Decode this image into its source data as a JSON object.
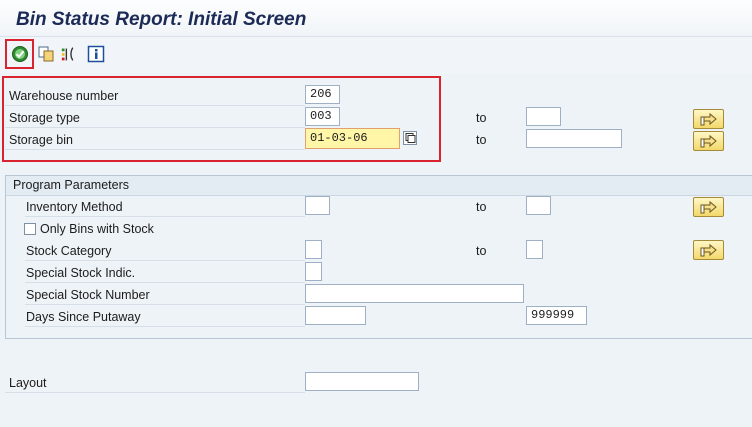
{
  "window": {
    "title": "Bin Status Report: Initial Screen"
  },
  "toolbar": {
    "items": [
      "execute-icon",
      "copy-variant-icon",
      "selection-options-icon",
      "info-icon"
    ]
  },
  "selection": {
    "warehouse": {
      "label": "Warehouse number",
      "value": "206"
    },
    "storage_type": {
      "label": "Storage type",
      "value": "003",
      "to_label": "to",
      "to_value": ""
    },
    "storage_bin": {
      "label": "Storage bin",
      "value": "01-03-06",
      "to_label": "to",
      "to_value": ""
    }
  },
  "program_parameters": {
    "title": "Program Parameters",
    "inventory_method": {
      "label": "Inventory Method",
      "value": "",
      "to_label": "to",
      "to_value": ""
    },
    "only_bins_with_stock": {
      "label": "Only Bins with Stock",
      "checked": false
    },
    "stock_category": {
      "label": "Stock Category",
      "value": "",
      "to_label": "to",
      "to_value": ""
    },
    "special_stock_indic": {
      "label": "Special Stock Indic.",
      "value": ""
    },
    "special_stock_number": {
      "label": "Special Stock Number",
      "value": ""
    },
    "days_since_putaway": {
      "label": "Days Since Putaway",
      "value": "",
      "to_value": "999999"
    }
  },
  "layout": {
    "label": "Layout",
    "value": ""
  },
  "colors": {
    "highlight": "#d9232e",
    "focus_field": "#fff6a8",
    "title": "#1b2a57"
  }
}
